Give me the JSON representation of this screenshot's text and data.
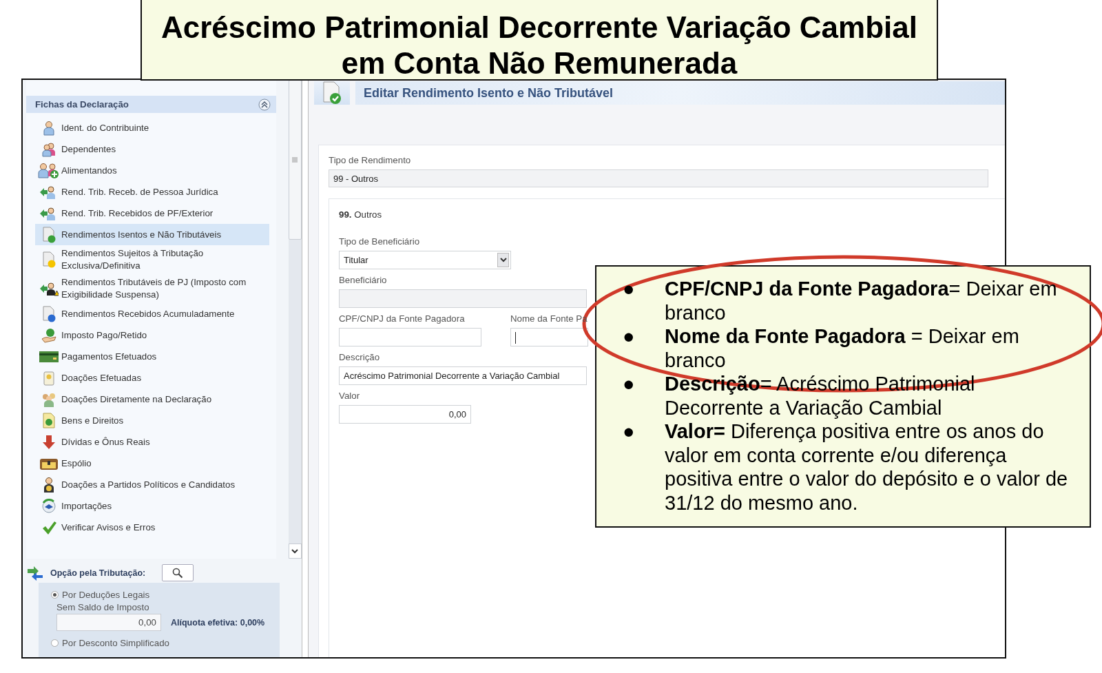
{
  "slide_title": "Acréscimo Patrimonial Decorrente Variação Cambial em Conta Não Remunerada",
  "sidebar": {
    "header": "Fichas da Declaração",
    "items": [
      {
        "label": "Ident. do Contribuinte",
        "selected": false
      },
      {
        "label": "Dependentes",
        "selected": false
      },
      {
        "label": "Alimentandos",
        "selected": false
      },
      {
        "label": "Rend. Trib. Receb. de Pessoa Jurídica",
        "selected": false
      },
      {
        "label": "Rend. Trib. Recebidos de PF/Exterior",
        "selected": false
      },
      {
        "label": "Rendimentos Isentos e Não Tributáveis",
        "selected": true
      },
      {
        "label": "Rendimentos Sujeitos à Tributação Exclusiva/Definitiva",
        "selected": false
      },
      {
        "label": "Rendimentos Tributáveis de PJ (Imposto com Exigibilidade Suspensa)",
        "selected": false
      },
      {
        "label": "Rendimentos Recebidos Acumuladamente",
        "selected": false
      },
      {
        "label": "Imposto Pago/Retido",
        "selected": false
      },
      {
        "label": "Pagamentos Efetuados",
        "selected": false
      },
      {
        "label": "Doações Efetuadas",
        "selected": false
      },
      {
        "label": "Doações Diretamente na Declaração",
        "selected": false
      },
      {
        "label": "Bens e Direitos",
        "selected": false
      },
      {
        "label": "Dívidas e Ônus Reais",
        "selected": false
      },
      {
        "label": "Espólio",
        "selected": false
      },
      {
        "label": "Doações a Partidos Políticos e Candidatos",
        "selected": false
      },
      {
        "label": "Importações",
        "selected": false
      },
      {
        "label": "Verificar Avisos e Erros",
        "selected": false
      }
    ]
  },
  "tax_option": {
    "label": "Opção pela Tributação:",
    "options": [
      {
        "label": "Por Deduções Legais",
        "selected": true
      },
      {
        "label": "Por Desconto Simplificado",
        "selected": false
      }
    ],
    "balance_label": "Sem Saldo de Imposto",
    "balance_value": "0,00",
    "rate": "Alíquota efetiva: 0,00%"
  },
  "form": {
    "title": "Editar Rendimento Isento e Não Tributável",
    "income_type": {
      "label": "Tipo de Rendimento",
      "value": "99 - Outros"
    },
    "section": "**99.** Outros",
    "rows": [
      {
        "fields": [
          {
            "kind": "select",
            "label": "Tipo de Beneficiário",
            "value": "Titular"
          }
        ]
      },
      {
        "fields": [
          {
            "kind": "disabled",
            "label": "Beneficiário"
          }
        ]
      },
      {
        "fields": [
          {
            "kind": "text",
            "label": "CPF/CNPJ da Fonte Pagadora",
            "focused": false
          },
          {
            "kind": "text",
            "label": "Nome da Fonte Pa",
            "focused": true
          }
        ]
      },
      {
        "fields": [
          {
            "kind": "text",
            "label": "Descrição",
            "value": "Acréscimo Patrimonial Decorrente a Variação Cambial",
            "focused": false
          }
        ]
      },
      {
        "fields": [
          {
            "kind": "number",
            "label": "Valor",
            "value": "0,00"
          }
        ]
      }
    ]
  },
  "callout": {
    "items": [
      {
        "bullet": "●",
        "text": "**CPF/CNPJ da Fonte Pagadora**= Deixar em branco"
      },
      {
        "bullet": "●",
        "text": "**Nome da Fonte Pagadora** = Deixar em branco"
      },
      {
        "bullet": "●",
        "text": "**Descrição**= Acréscimo Patrimonial Decorrente a Variação Cambial"
      },
      {
        "bullet": "●",
        "text": "**Valor=** Diferença positiva entre os anos do valor em conta corrente e/ou diferença positiva entre o valor do depósito e o valor de 31/12 do mesmo ano."
      }
    ]
  }
}
